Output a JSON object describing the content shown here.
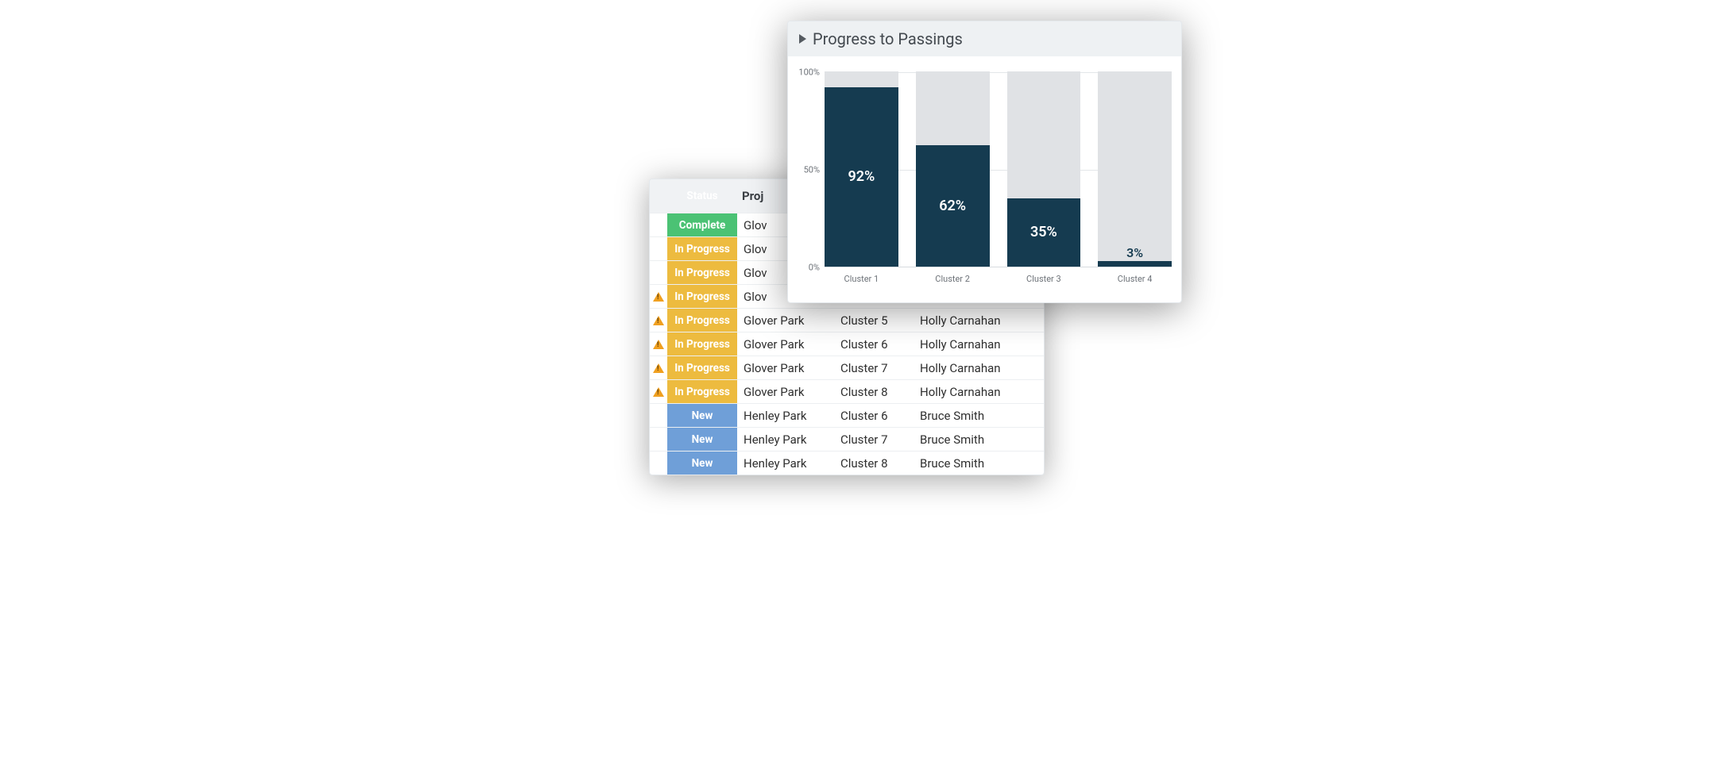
{
  "table": {
    "headers": {
      "status": "Status",
      "project": "Proj",
      "cluster": "",
      "owner": ""
    },
    "rows": [
      {
        "warn": false,
        "status": "Complete",
        "project": "Glov",
        "cluster": "",
        "owner": ""
      },
      {
        "warn": false,
        "status": "In Progress",
        "project": "Glov",
        "cluster": "",
        "owner": ""
      },
      {
        "warn": false,
        "status": "In Progress",
        "project": "Glov",
        "cluster": "",
        "owner": ""
      },
      {
        "warn": true,
        "status": "In Progress",
        "project": "Glov",
        "cluster": "",
        "owner": ""
      },
      {
        "warn": true,
        "status": "In Progress",
        "project": "Glover Park",
        "cluster": "Cluster 5",
        "owner": "Holly Carnahan"
      },
      {
        "warn": true,
        "status": "In Progress",
        "project": "Glover Park",
        "cluster": "Cluster 6",
        "owner": "Holly Carnahan"
      },
      {
        "warn": true,
        "status": "In Progress",
        "project": "Glover Park",
        "cluster": "Cluster 7",
        "owner": "Holly Carnahan"
      },
      {
        "warn": true,
        "status": "In Progress",
        "project": "Glover Park",
        "cluster": "Cluster 8",
        "owner": "Holly Carnahan"
      },
      {
        "warn": false,
        "status": "New",
        "project": "Henley Park",
        "cluster": "Cluster 6",
        "owner": "Bruce Smith"
      },
      {
        "warn": false,
        "status": "New",
        "project": "Henley Park",
        "cluster": "Cluster 7",
        "owner": "Bruce Smith"
      },
      {
        "warn": false,
        "status": "New",
        "project": "Henley Park",
        "cluster": "Cluster 8",
        "owner": "Bruce Smith"
      }
    ],
    "status_colors": {
      "Complete": "#4bc274",
      "In Progress": "#edbb3f",
      "New": "#6f9fd8"
    }
  },
  "chart": {
    "title": "Progress to Passings",
    "y_ticks": [
      "100%",
      "50%",
      "0%"
    ]
  },
  "chart_data": {
    "type": "bar",
    "title": "Progress to Passings",
    "categories": [
      "Cluster 1",
      "Cluster 2",
      "Cluster 3",
      "Cluster 4"
    ],
    "values": [
      92,
      62,
      35,
      3
    ],
    "ylabel": "",
    "xlabel": "",
    "ylim": [
      0,
      100
    ],
    "value_suffix": "%",
    "bar_fill_color": "#153b50",
    "bar_bg_color": "#e0e2e5"
  }
}
